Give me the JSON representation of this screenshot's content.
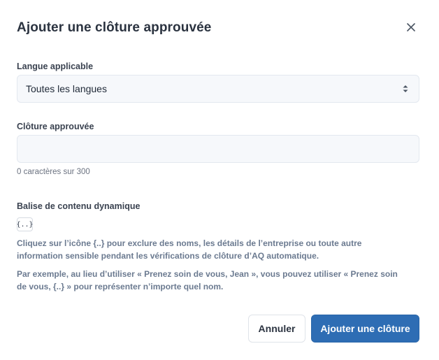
{
  "modal": {
    "title": "Ajouter une clôture approuvée",
    "close_icon": "close-icon"
  },
  "language": {
    "label": "Langue applicable",
    "selected": "Toutes les langues",
    "icon": "chevron-up-down-icon"
  },
  "closure": {
    "label": "Clôture approuvée",
    "value": "",
    "placeholder": "",
    "counter": "0 caractères sur 300"
  },
  "dynamic_tag": {
    "label": "Balise de contenu dynamique",
    "button_label": "{..}",
    "help_1": "Cliquez sur l’icône {..} pour exclure des noms, les détails de l’entreprise ou toute autre information sensible pendant les vérifications de clôture d’AQ automatique.",
    "help_2": "Par exemple, au lieu d’utiliser « Prenez soin de vous, Jean », vous pouvez utiliser « Prenez soin de vous, {..} » pour représenter n’importe quel nom."
  },
  "footer": {
    "cancel_label": "Annuler",
    "submit_label": "Ajouter une clôture"
  },
  "colors": {
    "primary": "#2e6db4",
    "field_bg": "#f6f8fb",
    "help_text": "#6b7a90"
  }
}
